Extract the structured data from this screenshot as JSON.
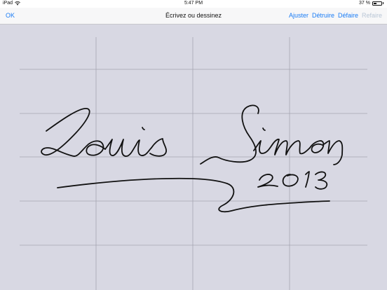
{
  "status_bar": {
    "device": "iPad",
    "time": "5:47 PM",
    "battery_percent": "37 %",
    "battery_level": 0.37
  },
  "nav_bar": {
    "ok_label": "OK",
    "title": "Écrivez ou dessinez",
    "actions": {
      "adjust": "Ajuster",
      "destroy": "Détruire",
      "undo": "Défaire",
      "redo": "Refaire"
    }
  },
  "colors": {
    "accent": "#1a7cf5",
    "disabled": "#b9c6d6",
    "canvas_bg": "#d8d8e3",
    "grid": "#a6a6b2",
    "ink": "#111111"
  },
  "icons": {
    "wifi": "wifi-icon",
    "battery": "battery-icon"
  }
}
